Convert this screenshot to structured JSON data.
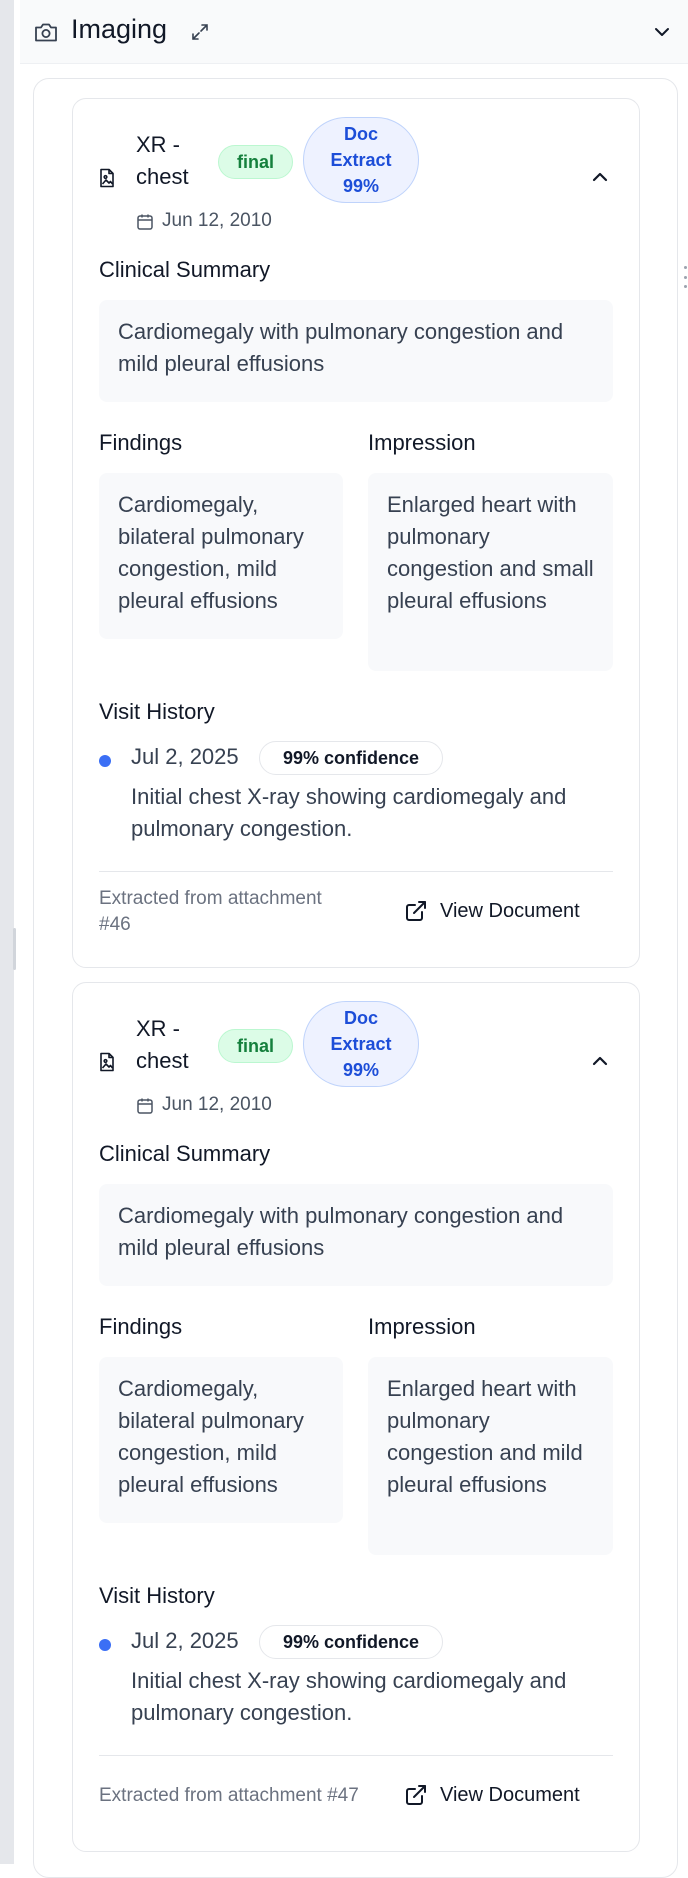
{
  "section": {
    "title": "Imaging",
    "icon": "camera-icon"
  },
  "reports": [
    {
      "title_line1": "XR -",
      "title_line2": "chest",
      "status": "final",
      "source_line1": "Doc",
      "source_line2": "Extract",
      "source_line3": "99%",
      "date": "Jun 12, 2010",
      "summary_label": "Clinical Summary",
      "summary": "Cardiomegaly with pulmonary congestion and mild pleural effusions",
      "findings_label": "Findings",
      "findings": "Cardiomegaly, bilateral pulmonary congestion, mild pleural effusions",
      "impression_label": "Impression",
      "impression": "Enlarged heart with pulmonary congestion and small pleural effusions",
      "visit_history_label": "Visit History",
      "visit_date": "Jul 2, 2025",
      "visit_confidence": "99% confidence",
      "visit_text": "Initial chest X-ray showing cardiomegaly and pulmonary congestion.",
      "extracted": "Extracted from attachment #46",
      "view_document": "View Document"
    },
    {
      "title_line1": "XR -",
      "title_line2": "chest",
      "status": "final",
      "source_line1": "Doc",
      "source_line2": "Extract",
      "source_line3": "99%",
      "date": "Jun 12, 2010",
      "summary_label": "Clinical Summary",
      "summary": "Cardiomegaly with pulmonary congestion and mild pleural effusions",
      "findings_label": "Findings",
      "findings": "Cardiomegaly, bilateral pulmonary congestion, mild pleural effusions",
      "impression_label": "Impression",
      "impression": "Enlarged heart with pulmonary congestion and mild pleural effusions",
      "visit_history_label": "Visit History",
      "visit_date": "Jul 2, 2025",
      "visit_confidence": "99% confidence",
      "visit_text": "Initial chest X-ray showing cardiomegaly and pulmonary congestion.",
      "extracted": "Extracted from attachment #47",
      "view_document": "View Document"
    }
  ],
  "colors": {
    "status_green": "#15803d",
    "doc_extract_blue": "#1d4ed8",
    "timeline_dot": "#3b6ff5"
  }
}
